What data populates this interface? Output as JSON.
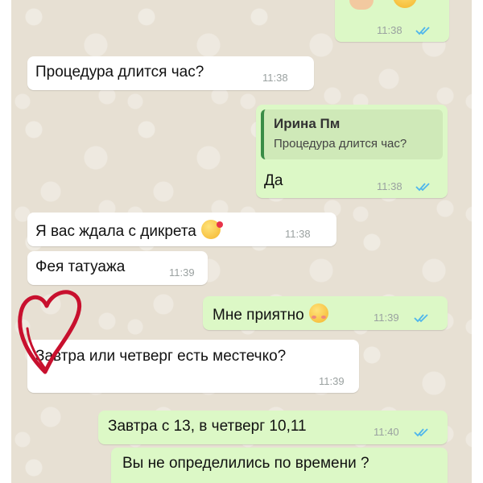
{
  "messages": [
    {
      "text": "",
      "time": "11:38",
      "dir": "out",
      "emoji": [
        "thumbs-up-emoji",
        "smiling-face-emoji"
      ]
    },
    {
      "text": "Процедура длится час?",
      "time": "11:38",
      "dir": "in"
    },
    {
      "reply_to": {
        "name": "Ирина Пм",
        "text": "Процедура длится час?"
      },
      "text": "Да",
      "time": "11:38",
      "dir": "out"
    },
    {
      "text": "Я вас ждала с дикрета",
      "time": "11:38",
      "dir": "in",
      "emoji": "smiling-face-with-hearts-emoji"
    },
    {
      "text": "Фея татуажа",
      "time": "11:39",
      "dir": "in"
    },
    {
      "text": "Мне приятно",
      "time": "11:39",
      "dir": "out",
      "emoji": "blushing-face-emoji"
    },
    {
      "text": "Завтра или четверг есть местечко?",
      "time": "11:39",
      "dir": "in"
    },
    {
      "text": "Завтра с 13, в четверг 10,11",
      "time": "11:40",
      "dir": "out"
    },
    {
      "text": "Вы не определились по времени ?",
      "time": "",
      "dir": "out"
    }
  ],
  "colors": {
    "incoming": "#ffffff",
    "outgoing": "#dcf8c6",
    "read_ticks": "#4fb6ec",
    "heart_doodle": "#c8102e"
  }
}
